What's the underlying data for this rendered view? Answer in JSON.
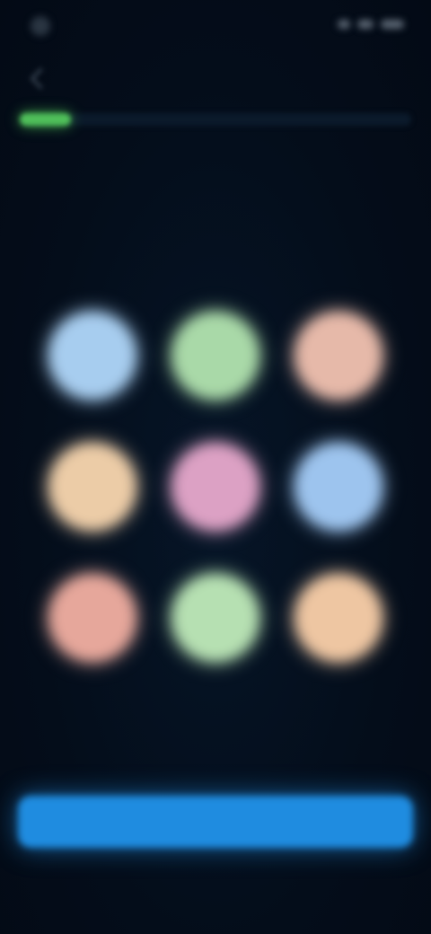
{
  "status_bar": {
    "time": ""
  },
  "progress": {
    "value": 0.13,
    "color": "#4fbf5a"
  },
  "prompt": {
    "text": ""
  },
  "choices": [
    {
      "color": "#a7cdef"
    },
    {
      "color": "#a9d9a8"
    },
    {
      "color": "#e6b9a9"
    },
    {
      "color": "#eccca7"
    },
    {
      "color": "#dca1c4"
    },
    {
      "color": "#9dc4ee"
    },
    {
      "color": "#e6a79b"
    },
    {
      "color": "#b6e0b2"
    },
    {
      "color": "#eec6a2"
    }
  ],
  "continue_button": {
    "label": "",
    "color": "#1f8ce0"
  }
}
